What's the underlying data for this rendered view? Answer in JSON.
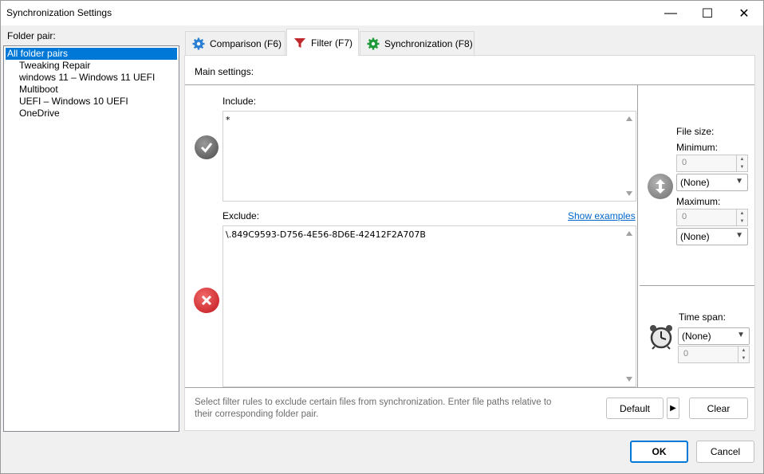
{
  "window": {
    "title": "Synchronization Settings"
  },
  "controls": {
    "minimize": "—",
    "maximize": "☐",
    "close": "✕"
  },
  "folder_pair": {
    "label": "Folder pair:",
    "items": [
      "All folder pairs",
      "Tweaking Repair",
      "windows 11 – Windows 11 UEFI",
      "Multiboot",
      "UEFI – Windows 10 UEFI",
      "OneDrive"
    ],
    "selected_index": 0
  },
  "tabs": [
    {
      "label": "Comparison (F6)",
      "icon": "gear-icon"
    },
    {
      "label": "Filter (F7)",
      "icon": "funnel-icon",
      "active": true
    },
    {
      "label": "Synchronization (F8)",
      "icon": "gear-green-icon"
    }
  ],
  "filter": {
    "main_settings_label": "Main settings:",
    "include_label": "Include:",
    "include_value": "*",
    "exclude_label": "Exclude:",
    "show_examples": "Show examples",
    "exclude_value": "\\.849C9593-D756-4E56-8D6E-42412F2A707B",
    "file_size_label": "File size:",
    "minimum_label": "Minimum:",
    "minimum_value": "0",
    "minimum_unit": "(None)",
    "maximum_label": "Maximum:",
    "maximum_value": "0",
    "maximum_unit": "(None)",
    "time_span_label": "Time span:",
    "time_span_value": "(None)",
    "time_span_number": "0",
    "hint": "Select filter rules to exclude certain files from synchronization. Enter file paths relative to their corresponding folder pair.",
    "default_button": "Default",
    "default_arrow": "▶",
    "clear_button": "Clear"
  },
  "footer": {
    "ok": "OK",
    "cancel": "Cancel"
  },
  "colors": {
    "selection": "#0078d7",
    "link": "#0066cc",
    "funnel": "#c0282d",
    "gear_blue": "#2a7fd4",
    "gear_green": "#1f9a3a"
  }
}
